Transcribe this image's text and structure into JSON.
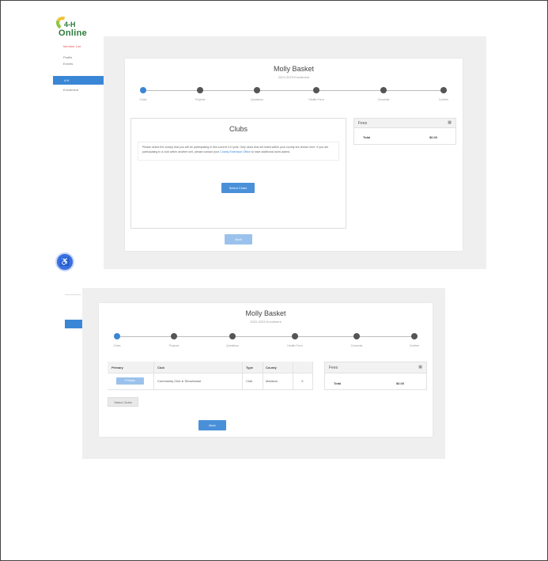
{
  "logo": {
    "line1": "4-H",
    "line2": "Online"
  },
  "sidebar": {
    "alert": "Member List",
    "items": [
      "Profile",
      "Events"
    ],
    "active": "4-H",
    "after": "Enrollment"
  },
  "help_icon": "accessibility-icon",
  "member": {
    "name": "Molly Basket",
    "subtitle": "2022-2023 Enrollment"
  },
  "steps": [
    "Clubs",
    "Projects",
    "Questions",
    "Health Form",
    "Consents",
    "Confirm"
  ],
  "clubs": {
    "title": "Clubs",
    "message_before": "Please select the club(s) that you will be participating in this current 4-H year. Only clubs that are listed within your county are shown here. If you are participating in a club within another unit, please contact your ",
    "message_link": "County Extension Office",
    "message_after": " to have additional clubs added.",
    "select_button": "Select Clubs"
  },
  "fees": {
    "title": "Fees",
    "total_label": "Total",
    "total_value": "$0.00",
    "icon": "calculator-icon"
  },
  "next_button": "Next",
  "table": {
    "headers": [
      "Primary",
      "Club",
      "Type",
      "County",
      ""
    ],
    "rows": [
      {
        "primary": "Primary",
        "club": "Community Club & Showhouse",
        "type": "Club",
        "county": "Madison",
        "action": "X"
      }
    ]
  },
  "select_more_button": "Select Clubs",
  "colors": {
    "accent": "#3a86d6",
    "alert": "#e55555",
    "panel_gray": "#efefef"
  }
}
